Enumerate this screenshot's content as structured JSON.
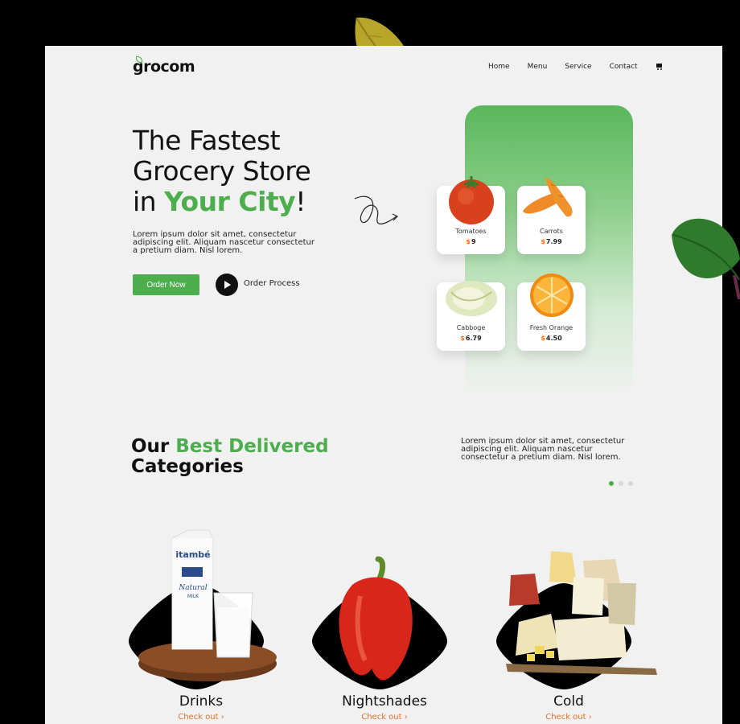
{
  "brand": {
    "logo": "grocom"
  },
  "nav": {
    "items": [
      "Home",
      "Menu",
      "Service",
      "Contact"
    ],
    "cart_icon": "cart-icon"
  },
  "hero": {
    "title_line1": "The Fastest",
    "title_line2": "Grocery Store",
    "title_line3_prefix": "in ",
    "title_line3_highlight": "Your City",
    "title_line3_suffix": "!",
    "description": "Lorem ipsum dolor sit amet, consectetur adipiscing elit. Aliquam nascetur consectetur a pretium diam. Nisl lorem.",
    "order_button": "Order Now",
    "process_label": "Order Process",
    "play_icon": "play-icon"
  },
  "products": [
    {
      "name": "Tomatoes",
      "currency": "$",
      "price": "9"
    },
    {
      "name": "Carrots",
      "currency": "$",
      "price": "7.99"
    },
    {
      "name": "Cabboge",
      "currency": "$",
      "price": "6.79"
    },
    {
      "name": "Fresh Orange",
      "currency": "$",
      "price": "4.50"
    }
  ],
  "categories_section": {
    "title_prefix": "Our ",
    "title_highlight": "Best Delivered",
    "title_line2": "Categories",
    "description": "Lorem ipsum dolor sit amet, consectetur adipiscing elit. Aliquam nascetur consectetur a pretium diam. Nisl lorem.",
    "carousel_active_index": 0,
    "carousel_count": 3
  },
  "categories": [
    {
      "name": "Drinks",
      "link": "Check out"
    },
    {
      "name": "Nightshades",
      "link": "Check out"
    },
    {
      "name": "Cold",
      "link": "Check out"
    }
  ],
  "product_labels": {
    "milk_brand": "itambé",
    "milk_line1": "Natural",
    "milk_line2": "MILK"
  },
  "colors": {
    "accent": "#4cae4c",
    "price": "#e8712a",
    "background": "#f1f1f1"
  }
}
